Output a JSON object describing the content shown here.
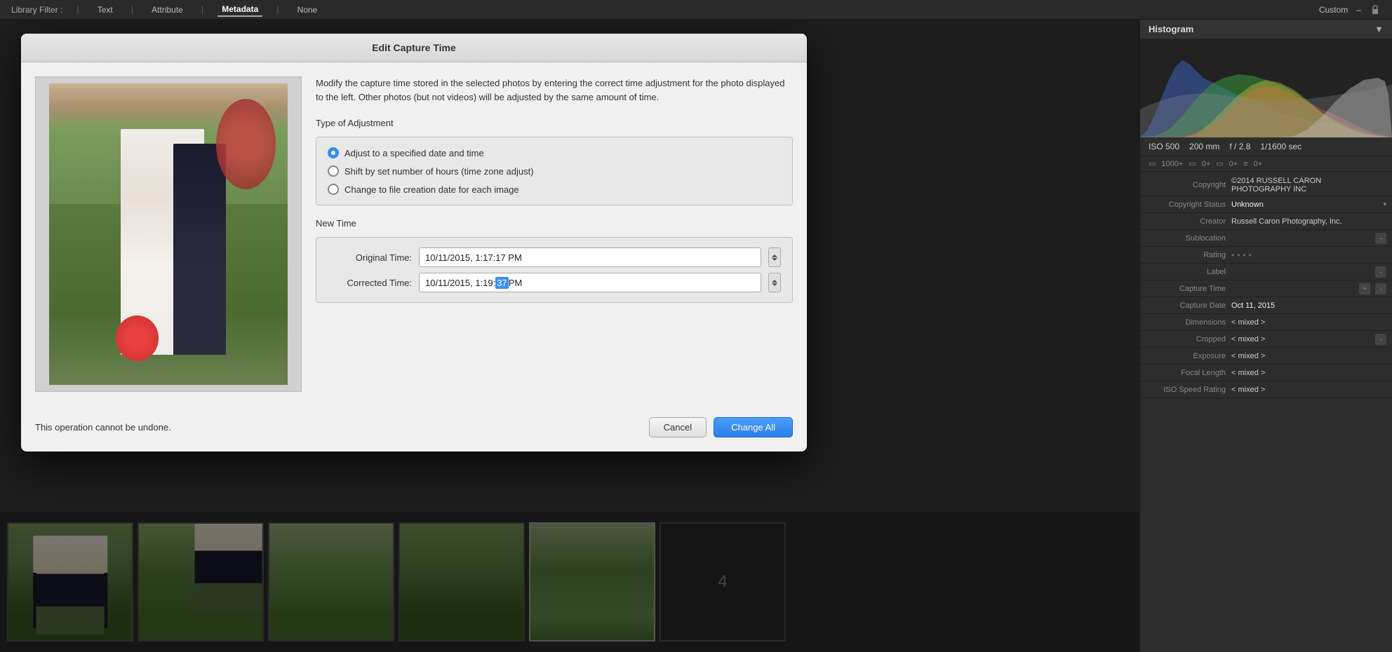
{
  "topbar": {
    "label": "Library Filter :",
    "tabs": [
      "Text",
      "Attribute",
      "Metadata",
      "None"
    ],
    "active_tab": "Metadata",
    "right_label": "Custom"
  },
  "dialog": {
    "title": "Edit Capture Time",
    "description": "Modify the capture time stored in the selected photos by entering the correct time adjustment for the photo displayed to the left. Other photos (but not videos) will be adjusted by the same amount of time.",
    "type_of_adjustment_label": "Type of Adjustment",
    "radio_options": [
      {
        "label": "Adjust to a specified date and time",
        "checked": true
      },
      {
        "label": "Shift by set number of hours (time zone adjust)",
        "checked": false
      },
      {
        "label": "Change to file creation date for each image",
        "checked": false
      }
    ],
    "new_time_label": "New Time",
    "original_time_label": "Original Time:",
    "original_time_value": "10/11/2015,  1:17:17 PM",
    "corrected_time_label": "Corrected Time:",
    "corrected_time_value_prefix": "10/11/2015,  1:19:",
    "corrected_time_highlight": "37",
    "corrected_time_suffix": " PM",
    "warning": "This operation cannot be undone.",
    "cancel_label": "Cancel",
    "change_all_label": "Change All"
  },
  "histogram": {
    "title": "Histogram",
    "chevron": "▼"
  },
  "camera_info": {
    "iso": "ISO 500",
    "focal_length": "200 mm",
    "aperture": "f / 2.8",
    "shutter": "1/1600 sec"
  },
  "panel_counts": {
    "count1": "1000+",
    "count2": "0+",
    "count3": "0+",
    "count4": "0+"
  },
  "metadata": {
    "copyright_label": "Copyright",
    "copyright_value1": "©2014 RUSSELL CARON",
    "copyright_value2": "PHOTOGRAPHY INC",
    "copyright_status_label": "Copyright Status",
    "copyright_status_value": "Unknown",
    "creator_label": "Creator",
    "creator_value": "Russell Caron Photography, Inc.",
    "sublocation_label": "Sublocation",
    "sublocation_value": "",
    "rating_label": "Rating",
    "rating_dots": [
      "•",
      "•",
      "•",
      "•"
    ],
    "label_label": "Label",
    "label_value": "",
    "capture_time_label": "Capture Time",
    "capture_time_value": "",
    "capture_date_label": "Capture Date",
    "capture_date_value": "Oct 11, 2015",
    "dimensions_label": "Dimensions",
    "dimensions_value": "< mixed >",
    "cropped_label": "Cropped",
    "cropped_value": "< mixed >",
    "exposure_label": "Exposure",
    "exposure_value": "< mixed >",
    "focal_length_label": "Focal Length",
    "focal_length_value": "< mixed >",
    "iso_label": "ISO Speed Rating",
    "iso_value": "< mixed >"
  }
}
